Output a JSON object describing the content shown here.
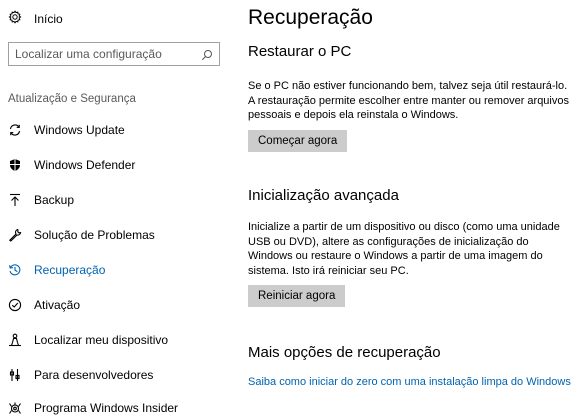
{
  "sidebar": {
    "home_label": "Início",
    "search": {
      "placeholder": "Localizar uma configuração"
    },
    "section_label": "Atualização e Segurança",
    "items": [
      {
        "label": "Windows Update",
        "icon": "refresh-icon"
      },
      {
        "label": "Windows Defender",
        "icon": "shield-icon"
      },
      {
        "label": "Backup",
        "icon": "backup-arrow-icon"
      },
      {
        "label": "Solução de Problemas",
        "icon": "wrench-icon"
      },
      {
        "label": "Recuperação",
        "icon": "history-icon",
        "active": true
      },
      {
        "label": "Ativação",
        "icon": "check-circle-icon"
      },
      {
        "label": "Localizar meu dispositivo",
        "icon": "person-location-icon"
      },
      {
        "label": "Para desenvolvedores",
        "icon": "developer-tools-icon"
      },
      {
        "label": "Programa Windows Insider",
        "icon": "insider-icon"
      }
    ]
  },
  "main": {
    "title": "Recuperação",
    "reset": {
      "heading": "Restaurar o PC",
      "description": "Se o PC não estiver funcionando bem, talvez seja útil restaurá-lo. A restauração permite escolher entre manter ou remover arquivos pessoais e depois ela reinstala o Windows.",
      "button": "Começar agora"
    },
    "advanced": {
      "heading": "Inicialização avançada",
      "description": "Inicialize a partir de um dispositivo ou disco (como uma unidade USB ou DVD), altere as configurações de inicialização do Windows ou restaure o Windows a partir de uma imagem do sistema. Isto irá reiniciar seu PC.",
      "button": "Reiniciar agora"
    },
    "more": {
      "heading": "Mais opções de recuperação",
      "link": "Saiba como iniciar do zero com uma instalação limpa do Windows"
    }
  },
  "colors": {
    "accent": "#0063b1",
    "button_bg": "#cccccc"
  }
}
